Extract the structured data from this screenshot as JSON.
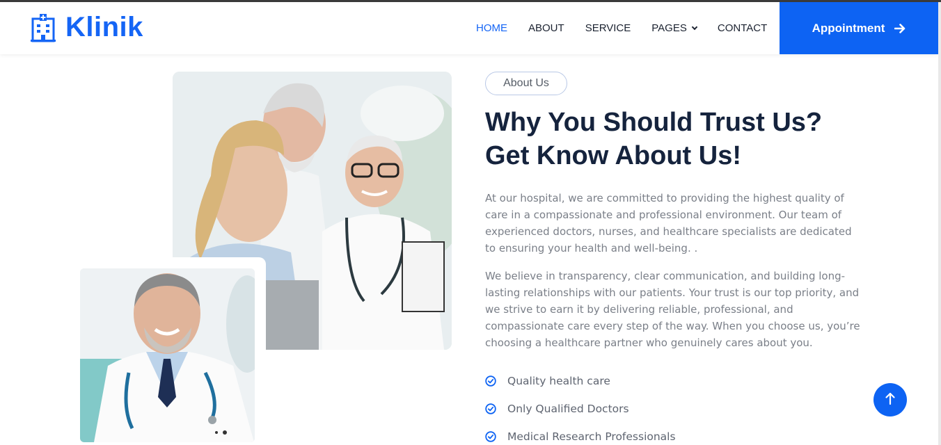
{
  "brand": {
    "name": "Klinik",
    "icon": "hospital-building-icon"
  },
  "nav": {
    "items": [
      {
        "label": "HOME",
        "active": true
      },
      {
        "label": "ABOUT",
        "active": false
      },
      {
        "label": "SERVICE",
        "active": false
      },
      {
        "label": "PAGES",
        "active": false,
        "has_dropdown": true
      },
      {
        "label": "CONTACT",
        "active": false
      }
    ],
    "cta_label": "Appointment",
    "cta_icon": "arrow-right-icon"
  },
  "about": {
    "badge": "About Us",
    "heading_line1": "Why You Should Trust Us?",
    "heading_line2": "Get Know About Us!",
    "paragraph1": "At our hospital, we are committed to providing the highest quality of care in a compassionate and professional environment. Our team of experienced doctors, nurses, and healthcare specialists are dedicated to ensuring your health and well-being. .",
    "paragraph2": "We believe in transparency, clear communication, and building long-lasting relationships with our patients. Your trust is our top priority, and we strive to earn it by delivering reliable, professional, and compassionate care every step of the way. When you choose us, you’re choosing a healthcare partner who genuinely cares about you.",
    "features": [
      "Quality health care",
      "Only Qualified Doctors",
      "Medical Research Professionals"
    ]
  },
  "colors": {
    "accent": "#0d63f3",
    "heading": "#15233d",
    "text": "#7a7f88"
  },
  "back_to_top_icon": "arrow-up-icon"
}
